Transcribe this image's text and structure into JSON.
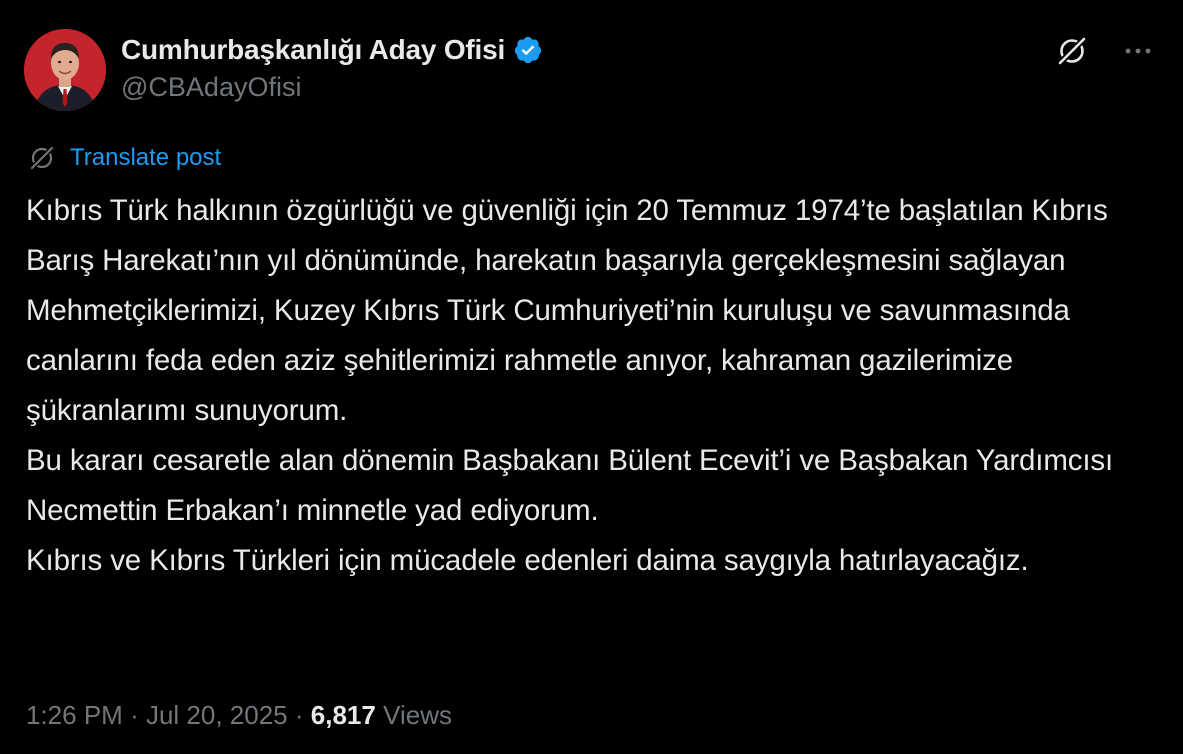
{
  "colors": {
    "background": "#000000",
    "text_primary": "#e7e9ea",
    "text_secondary": "#71767b",
    "accent": "#1d9bf0"
  },
  "author": {
    "display_name": "Cumhurbaşkanlığı Aday Ofisi",
    "handle": "@CBAdayOfisi",
    "verified": true,
    "avatar_icon": "avatar-photo"
  },
  "actions": {
    "grok_icon": "grok-icon",
    "more_icon": "more-options-icon"
  },
  "translate": {
    "label": "Translate post",
    "icon": "translate-icon"
  },
  "post": {
    "paragraphs": [
      "Kıbrıs Türk halkının özgürlüğü ve güvenliği için 20 Temmuz 1974’te başlatılan Kıbrıs Barış Harekatı’nın yıl dönümünde, harekatın başarıyla gerçekleşmesini sağlayan Mehmetçiklerimizi, Kuzey Kıbrıs Türk Cumhuriyeti’nin kuruluşu ve savunmasında canlarını feda eden aziz şehitlerimizi rahmetle anıyor, kahraman gazilerimize şükranlarımı sunuyorum.",
      "Bu kararı cesaretle alan dönemin Başbakanı Bülent Ecevit’i ve Başbakan Yardımcısı Necmettin Erbakan’ı minnetle yad ediyorum.",
      "Kıbrıs ve Kıbrıs Türkleri için mücadele edenleri daima saygıyla hatırlayacağız."
    ]
  },
  "meta": {
    "time": "1:26 PM",
    "separator": "·",
    "date": "Jul 20, 2025",
    "views_count": "6,817",
    "views_label": "Views"
  }
}
